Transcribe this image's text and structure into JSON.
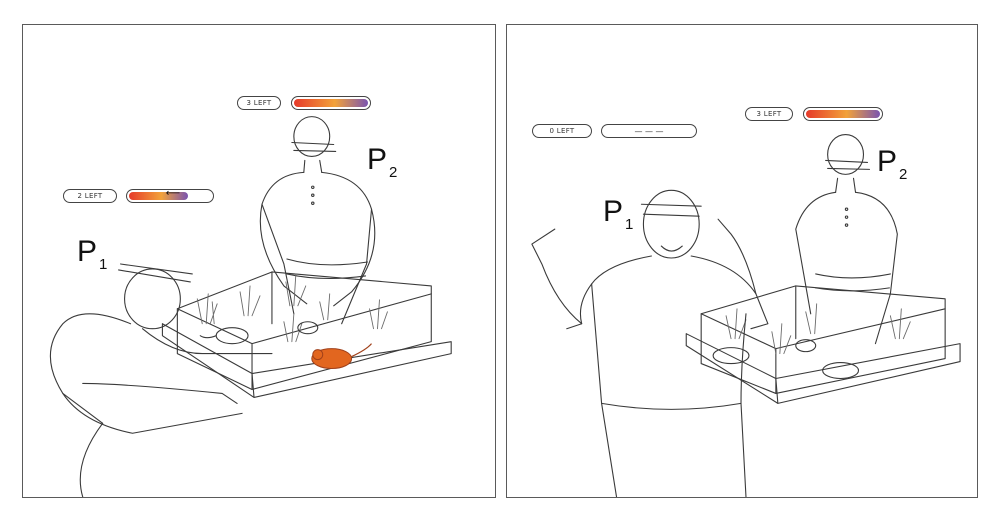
{
  "left_panel": {
    "p1": {
      "counter": "2 LEFT",
      "bar_fill": 0.72,
      "label": "P",
      "sub": "1"
    },
    "p2": {
      "counter": "3 LEFT",
      "bar_fill": 1.0,
      "label": "P",
      "sub": "2"
    }
  },
  "right_panel": {
    "p1": {
      "counter": "0 LEFT",
      "bar_text": "— — —",
      "label": "P",
      "sub": "1"
    },
    "p2": {
      "counter": "3 LEFT",
      "bar_fill": 1.0,
      "label": "P",
      "sub": "2"
    }
  },
  "colors": {
    "gradient_start": "#e63a2a",
    "gradient_mid": "#f2a23a",
    "gradient_end": "#7a54b0",
    "highlighted_mouse": "#e2661f",
    "outline": "#444444"
  },
  "icons": [
    "arrow-left-icon",
    "mouse-icon",
    "ar-headset-icon"
  ]
}
